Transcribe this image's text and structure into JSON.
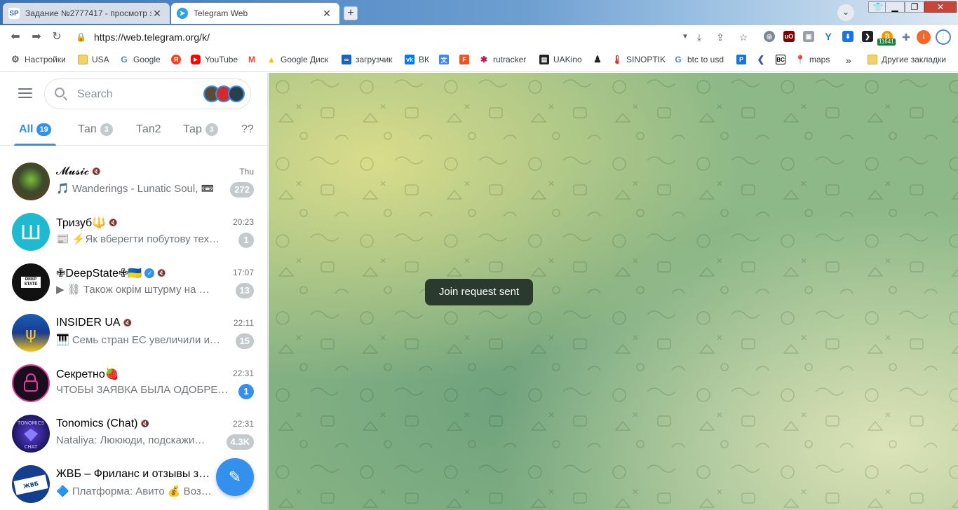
{
  "browser": {
    "tabs": [
      {
        "favicon": "SP",
        "title": "Задание №2777417 - просмотр з"
      },
      {
        "favicon": "telegram-icon",
        "title": "Telegram Web"
      }
    ],
    "url": "https://web.telegram.org/k/",
    "bookmarks": [
      {
        "icon": "gear-icon",
        "label": "Настройки"
      },
      {
        "icon": "folder-icon",
        "label": "USA"
      },
      {
        "icon": "google-icon",
        "label": "Google"
      },
      {
        "icon": "yandex-icon",
        "label": ""
      },
      {
        "icon": "youtube-icon",
        "label": "YouTube"
      },
      {
        "icon": "gmail-icon",
        "label": ""
      },
      {
        "icon": "google-drive-icon",
        "label": "Google Диск"
      },
      {
        "icon": "infinity-icon",
        "label": "загрузчик"
      },
      {
        "icon": "vk-icon",
        "label": "ВК"
      },
      {
        "icon": "translate-icon",
        "label": ""
      },
      {
        "icon": "f-icon",
        "label": ""
      },
      {
        "icon": "rutracker-icon",
        "label": "rutracker"
      },
      {
        "icon": "film-icon",
        "label": "UAKino"
      },
      {
        "icon": "chess-icon",
        "label": ""
      },
      {
        "icon": "thermometer-icon",
        "label": "SINOPTIK"
      },
      {
        "icon": "google-icon",
        "label": "btc to usd"
      },
      {
        "icon": "p-icon",
        "label": ""
      },
      {
        "icon": "arrow-icon",
        "label": ""
      },
      {
        "icon": "bc-icon",
        "label": ""
      },
      {
        "icon": "maps-icon",
        "label": "maps"
      }
    ],
    "other_bookmarks": "Другие закладки",
    "more_bookmarks": "»",
    "ext_badge": "11641",
    "avatar_letter": "I"
  },
  "telegram": {
    "search_placeholder": "Search",
    "folders": [
      {
        "label": "All",
        "count": "19"
      },
      {
        "label": "Тап",
        "count": "3"
      },
      {
        "label": "Тап2",
        "count": ""
      },
      {
        "label": "Тар",
        "count": "3"
      },
      {
        "label": "??",
        "count": ""
      }
    ],
    "chats": [
      {
        "name": "𝓜𝓾𝓼𝓲𝓬",
        "muted": true,
        "time": "Thu",
        "preview": "🎵 Wanderings - Lunatic Soul, 📼",
        "badge": "272",
        "badge_muted": true,
        "avatar_color": "#3b4a2c"
      },
      {
        "name": "Тризуб🔱",
        "muted": true,
        "time": "20:23",
        "preview": "📰 ⚡Як вберегти побутову тех…",
        "badge": "1",
        "badge_muted": true,
        "avatar_color": "#1fb9d0"
      },
      {
        "name": "✙DeepState✙🇺🇦",
        "muted": true,
        "verified": true,
        "time": "17:07",
        "preview": "▶ ⛓ Також окрім штурму на …",
        "badge": "13",
        "badge_muted": true,
        "avatar_color": "#111111"
      },
      {
        "name": "INSIDER UA",
        "muted": true,
        "time": "22:11",
        "preview": "🎹 Семь стран ЕС увеличили и…",
        "badge": "15",
        "badge_muted": true,
        "avatar_color": "#1a3b8f"
      },
      {
        "name": "Секретно🍓",
        "muted": false,
        "time": "22:31",
        "preview": "ЧТОБЫ ЗАЯВКА БЫЛА ОДОБРЕ…",
        "badge": "1",
        "badge_muted": false,
        "avatar_color": "#1a0d1e"
      },
      {
        "name": "Tonomics (Chat)",
        "muted": true,
        "time": "22:31",
        "preview": "Nataliya: Люююди, подскажи…",
        "badge": "4.3K",
        "badge_muted": true,
        "avatar_color": "#1d1660"
      },
      {
        "name": "ЖВБ – Фриланс и отзывы з…",
        "muted": false,
        "time": "",
        "preview": "🔷 Платформа: Авито 💰 Воз…",
        "badge": "",
        "badge_muted": true,
        "avatar_color": "#163e8f"
      }
    ],
    "toast": "Join request sent"
  },
  "colors": {
    "accent": "#3390ec",
    "tab_strip": "#3a74b8",
    "toast_bg": "#2b3a2e"
  }
}
